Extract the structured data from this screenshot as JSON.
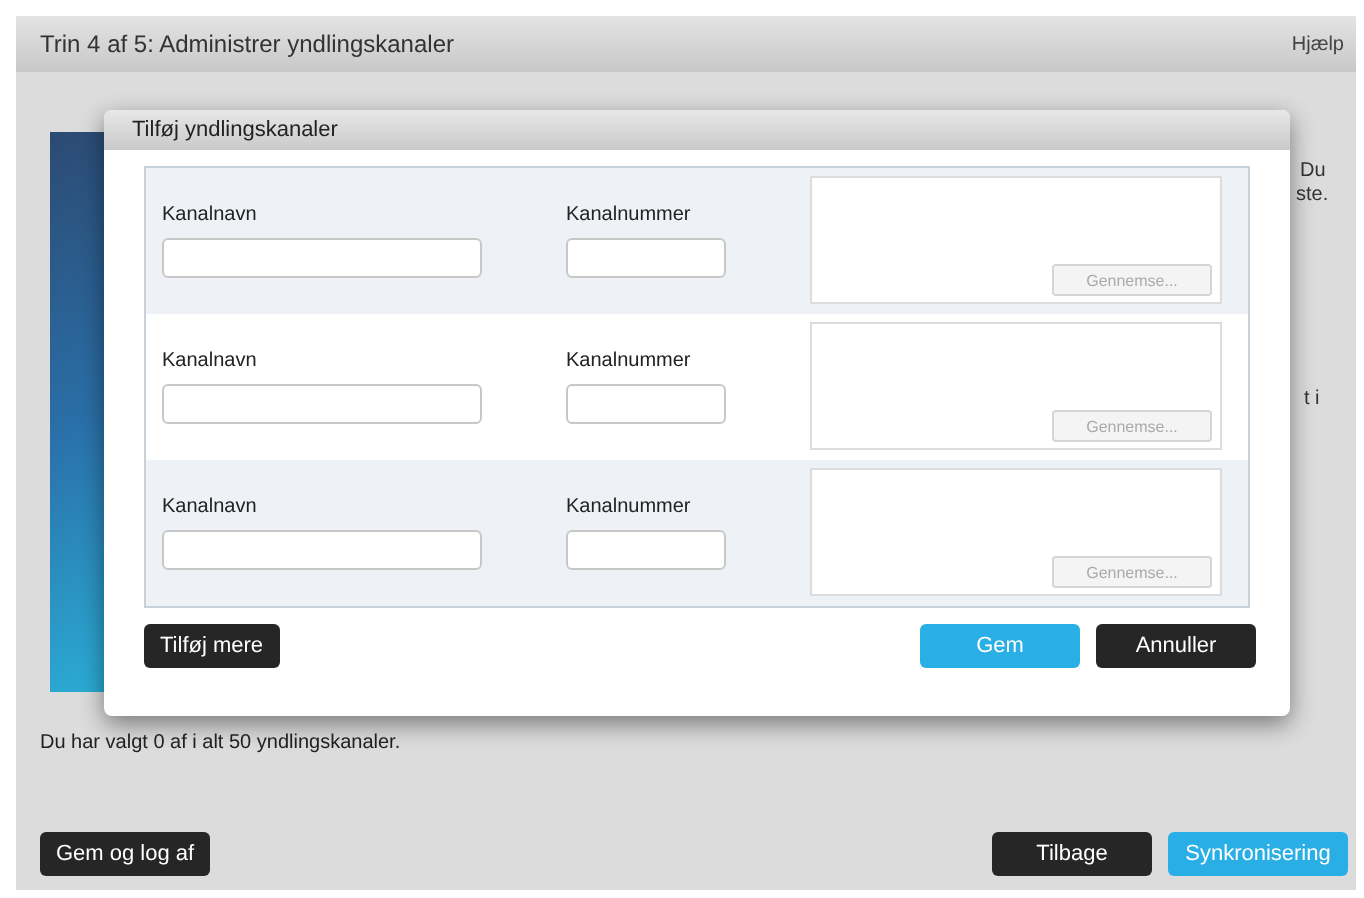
{
  "header": {
    "title": "Trin 4 af 5: Administrer yndlingskanaler",
    "help": "Hjælp"
  },
  "background_fragments": [
    "Du",
    "ste.",
    "t i"
  ],
  "status_text": "Du har valgt 0 af i alt 50 yndlingskanaler.",
  "footer": {
    "left_button": "Gem og log af",
    "buttons": [
      {
        "label": "Tilbage",
        "kind": "dark"
      },
      {
        "label": "Synkronisering",
        "kind": "primary"
      }
    ]
  },
  "dialog": {
    "title": "Tilføj yndlingskanaler",
    "rows": [
      {
        "name_label": "Kanalnavn",
        "number_label": "Kanalnummer",
        "browse": "Gennemse...",
        "browse_disabled": true
      },
      {
        "name_label": "Kanalnavn",
        "number_label": "Kanalnummer",
        "browse": "Gennemse...",
        "browse_disabled": true
      },
      {
        "name_label": "Kanalnavn",
        "number_label": "Kanalnummer",
        "browse": "Gennemse...",
        "browse_disabled": true
      }
    ],
    "add_more": "Tilføj mere",
    "buttons": [
      {
        "label": "Gem",
        "kind": "primary"
      },
      {
        "label": "Annuller",
        "kind": "dark"
      }
    ]
  }
}
